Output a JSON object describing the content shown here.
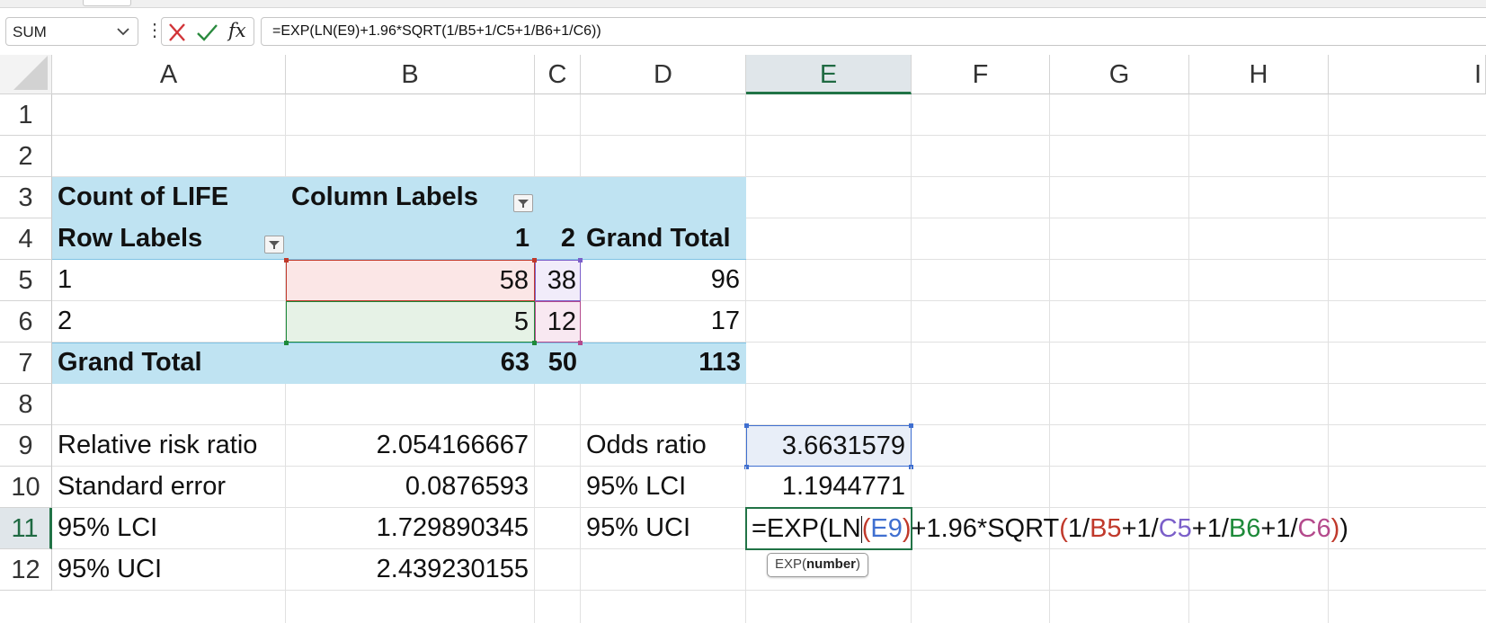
{
  "name_box": {
    "value": "SUM"
  },
  "formula_bar": {
    "cancel_icon": "close-icon",
    "enter_icon": "check-icon",
    "fx_label": "fx",
    "formula": "=EXP(LN(E9)+1.96*SQRT(1/B5+1/C5+1/B6+1/C6))"
  },
  "colors": {
    "pivot_fill": "#bfe3f2",
    "selection_green": "#217346",
    "ref_blue": "#3f6fd0",
    "ref_red": "#c0392b",
    "ref_purple": "#7b5fc9",
    "ref_green": "#1e8a3a",
    "ref_magenta": "#b44a8c"
  },
  "columns": [
    "A",
    "B",
    "C",
    "D",
    "E",
    "F",
    "G",
    "H",
    "I"
  ],
  "rows": [
    "1",
    "2",
    "3",
    "4",
    "5",
    "6",
    "7",
    "8",
    "9",
    "10",
    "11",
    "12"
  ],
  "cells": {
    "A3": "Count of LIFE",
    "B3": "Column Labels",
    "A4": "Row Labels",
    "B4": "1",
    "C4": "2",
    "D4": "Grand Total",
    "A5": "1",
    "B5": "58",
    "C5": "38",
    "D5": "96",
    "A6": "2",
    "B6": "5",
    "C6": "12",
    "D6": "17",
    "A7": "Grand Total",
    "B7": "63",
    "C7": "50",
    "D7": "113",
    "A9": "Relative risk ratio",
    "B9": "2.054166667",
    "D9": "Odds ratio",
    "E9": "3.6631579",
    "A10": "Standard error",
    "B10": "0.0876593",
    "D10": "95% LCI",
    "E10": "1.1944771",
    "A11": "95% LCI",
    "B11": "1.729890345",
    "D11": "95% UCI",
    "A12": "95% UCI",
    "B12": "2.439230155"
  },
  "editing": {
    "seg1": "=EXP(LN",
    "p1": "(",
    "r1": "E9",
    "p2": ")",
    "seg2": "+1.96*SQRT",
    "p3": "(",
    "seg3": "1/",
    "r2": "B5",
    "seg4": "+1/",
    "r3": "C5",
    "seg5": "+1/",
    "r4": "B6",
    "seg6": "+1/",
    "r5": "C6",
    "p4": ")",
    "p5": ")"
  },
  "tooltip": {
    "fn": "EXP(",
    "arg": "number",
    "close": ")"
  }
}
